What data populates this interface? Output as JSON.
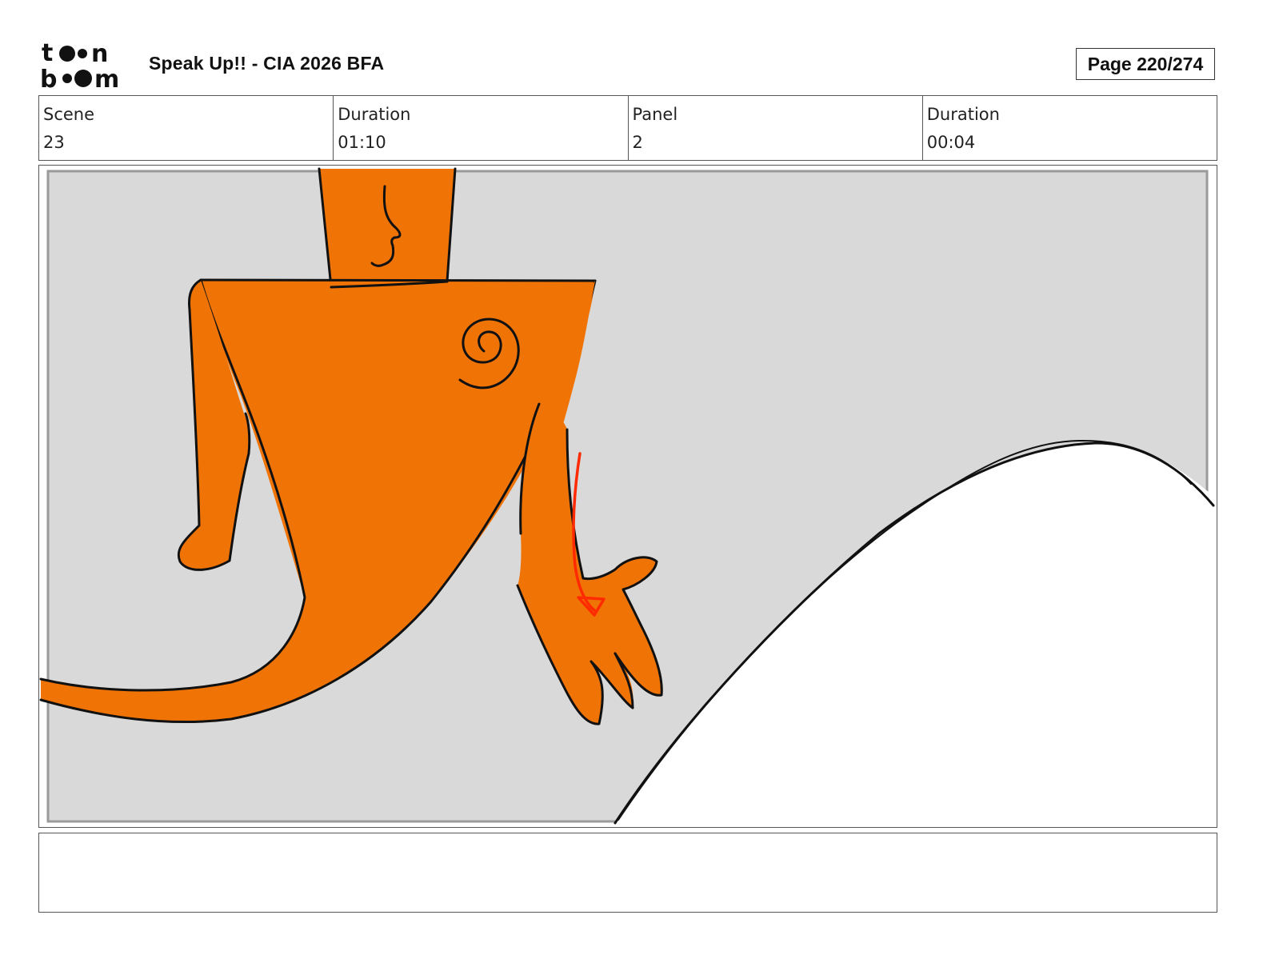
{
  "header": {
    "logo_text_top": "toon",
    "logo_text_bottom": "boom",
    "project_title": "Speak Up!! - CIA 2026 BFA",
    "page_label": "Page 220/274"
  },
  "info": {
    "scene_label": "Scene",
    "scene_value": "23",
    "scene_duration_label": "Duration",
    "scene_duration_value": "01:10",
    "panel_label": "Panel",
    "panel_value": "2",
    "panel_duration_label": "Duration",
    "panel_duration_value": "00:04"
  },
  "panel": {
    "background_color": "#d9d9d9",
    "character_color": "#f07305",
    "arrow_color": "#ff2a00",
    "outline_color": "#111111"
  },
  "notes": {
    "text": ""
  }
}
